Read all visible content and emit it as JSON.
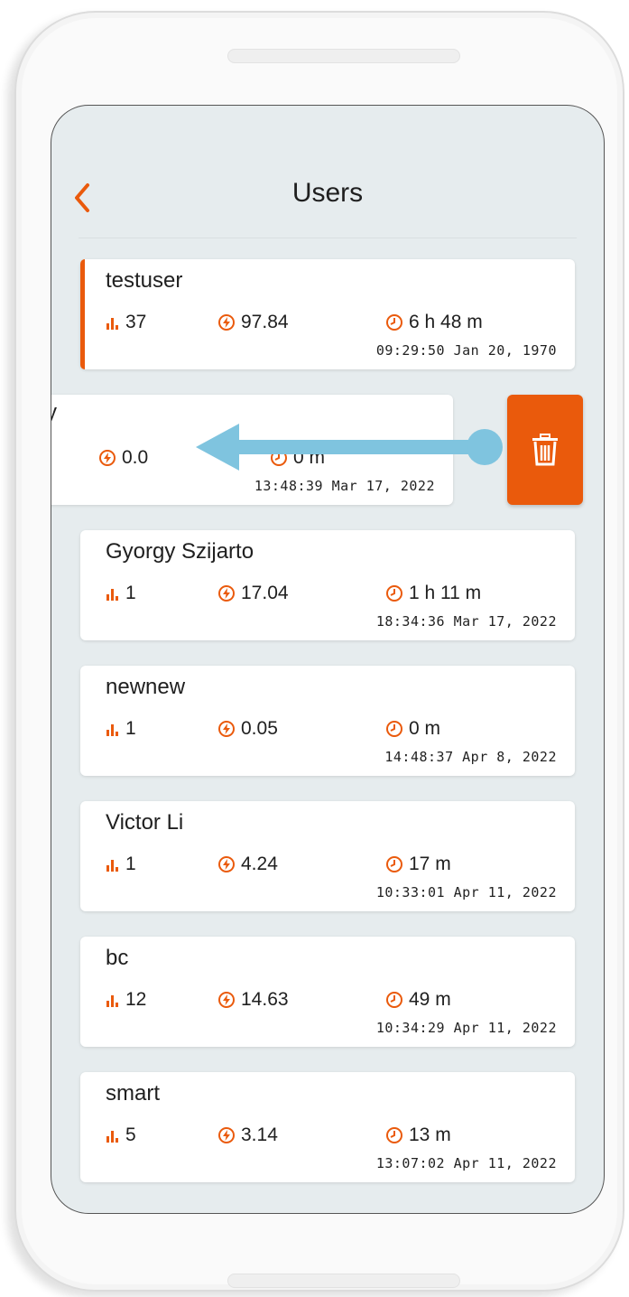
{
  "header": {
    "title": "Users",
    "back_icon": "chevron-left-icon",
    "accent_color": "#ea5a0c"
  },
  "users": [
    {
      "name": "testuser",
      "level": "37",
      "energy": "97.84",
      "time": "6 h 48 m",
      "date": "09:29:50 Jan 20, 1970",
      "selected": true
    },
    {
      "name": "y",
      "energy": "0.0",
      "time": "0 m",
      "date": "13:48:39 Mar 17, 2022",
      "swiped": true
    },
    {
      "name": "Gyorgy Szijarto",
      "level": "1",
      "energy": "17.04",
      "time": "1 h 11 m",
      "date": "18:34:36 Mar 17, 2022"
    },
    {
      "name": "newnew",
      "level": "1",
      "energy": "0.05",
      "time": "0 m",
      "date": "14:48:37 Apr 8, 2022"
    },
    {
      "name": "Victor Li",
      "level": "1",
      "energy": "4.24",
      "time": "17 m",
      "date": "10:33:01 Apr 11, 2022"
    },
    {
      "name": "bc",
      "level": "12",
      "energy": "14.63",
      "time": "49 m",
      "date": "10:34:29 Apr 11, 2022"
    },
    {
      "name": "smart",
      "level": "5",
      "energy": "3.14",
      "time": "13 m",
      "date": "13:07:02 Apr 11, 2022"
    }
  ],
  "delete_action": {
    "icon": "trash-icon",
    "color": "#ea5a0c"
  },
  "gesture_hint": {
    "icon": "swipe-left-arrow-icon",
    "color": "#7fc4df"
  }
}
